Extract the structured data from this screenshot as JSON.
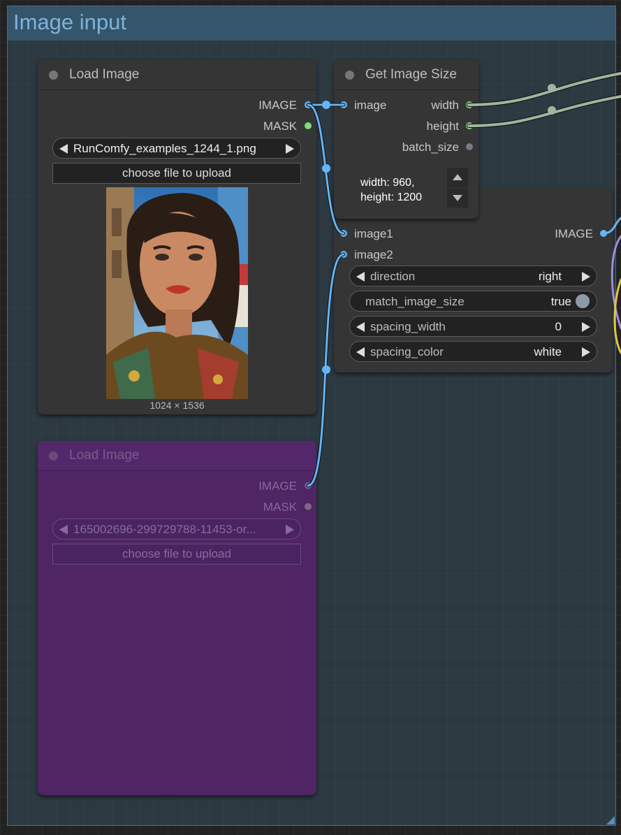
{
  "group": {
    "title": "Image input"
  },
  "load_image_1": {
    "title": "Load Image",
    "outputs": [
      "IMAGE",
      "MASK"
    ],
    "file": "RunComfy_examples_1244_1.png",
    "upload_label": "choose file to upload",
    "dimensions": "1024 × 1536"
  },
  "load_image_2": {
    "title": "Load Image",
    "outputs": [
      "IMAGE",
      "MASK"
    ],
    "file": "165002696-299729788-11453-or...",
    "upload_label": "choose file to upload"
  },
  "get_image_size": {
    "title": "Get Image Size",
    "input": "image",
    "outputs": [
      "width",
      "height",
      "batch_size"
    ],
    "preview_line1": "width: 960,",
    "preview_line2": "height: 1200"
  },
  "concat_node": {
    "inputs": [
      "image1",
      "image2"
    ],
    "output": "IMAGE",
    "widgets": [
      {
        "label": "direction",
        "value": "right"
      },
      {
        "label": "match_image_size",
        "value": "true"
      },
      {
        "label": "spacing_width",
        "value": "0"
      },
      {
        "label": "spacing_color",
        "value": "white"
      }
    ]
  },
  "colors": {
    "image_slot": "#64b5f6",
    "int_slot": "#7ddb7d",
    "wire_image": "#64b5f6",
    "wire_int": "#9fb59f",
    "group_header": "#35556b",
    "bypassed_node": "#4f2563"
  }
}
